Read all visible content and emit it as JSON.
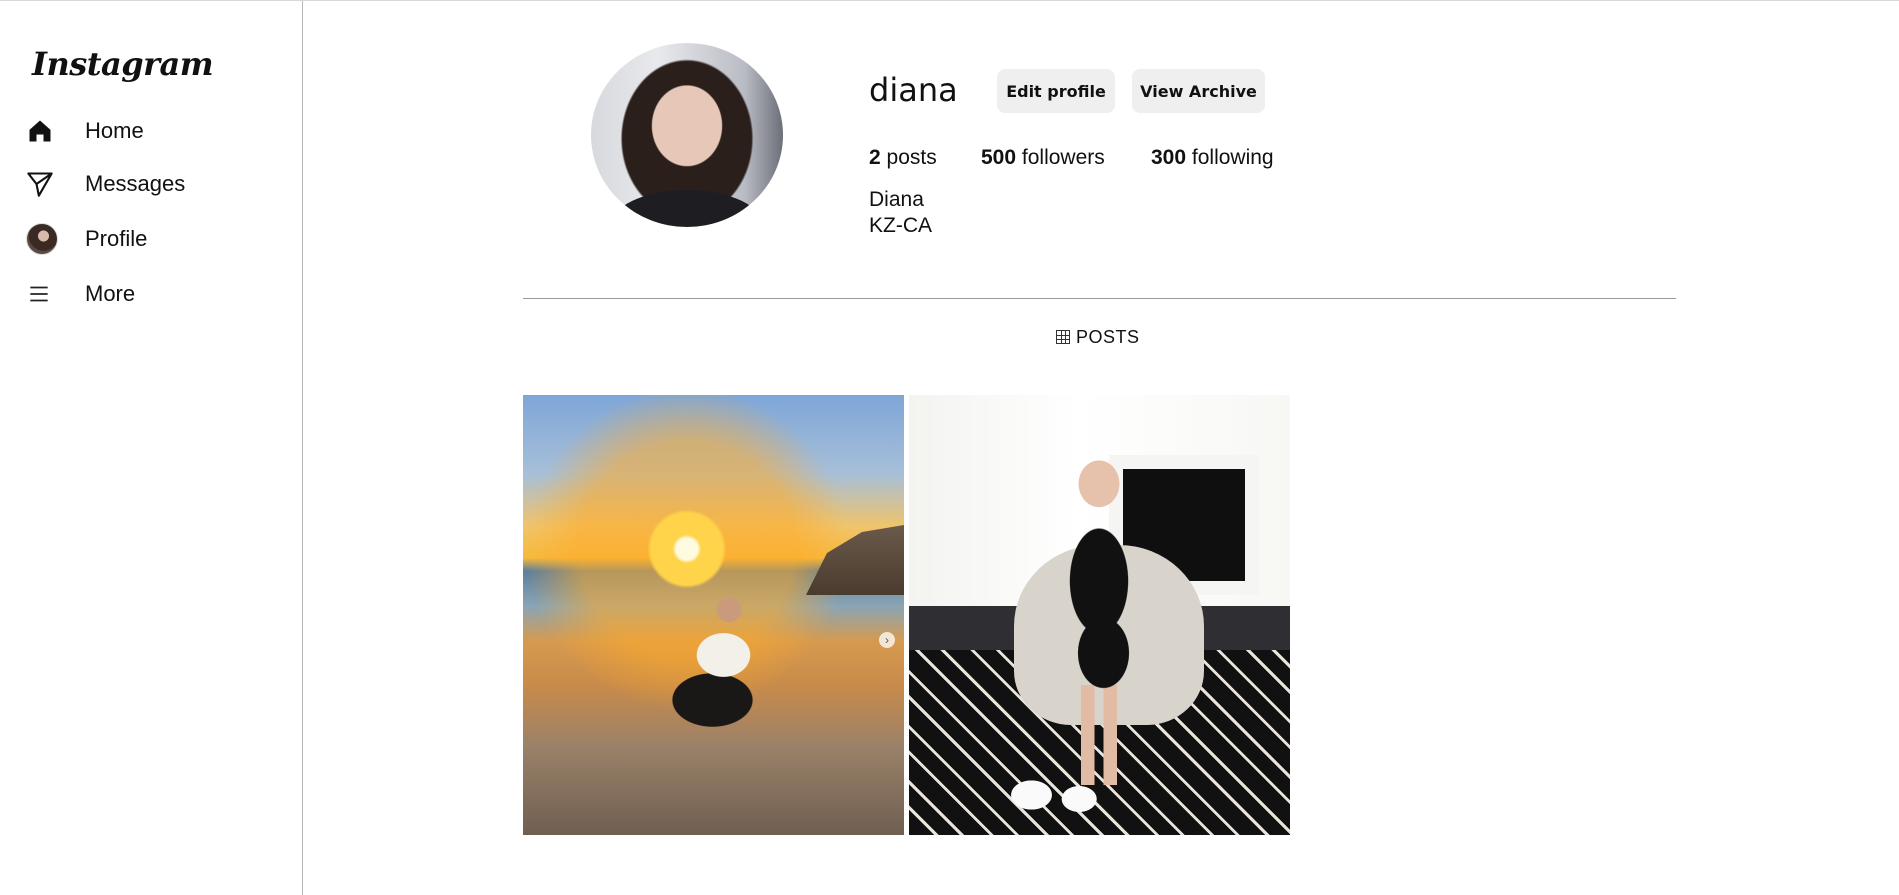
{
  "sidebar": {
    "logo": "Instagram",
    "items": [
      {
        "label": "Home",
        "icon": "home-icon"
      },
      {
        "label": "Messages",
        "icon": "send-icon"
      },
      {
        "label": "Profile",
        "icon": "avatar"
      },
      {
        "label": "More",
        "icon": "menu-icon"
      }
    ]
  },
  "profile": {
    "username": "diana",
    "edit_label": "Edit profile",
    "archive_label": "View Archive",
    "posts_count": "2",
    "posts_label": "posts",
    "followers_count": "500",
    "followers_label": "followers",
    "following_count": "300",
    "following_label": "following",
    "full_name": "Diana",
    "bio": "KZ-CA"
  },
  "tabs": {
    "posts_label": "POSTS",
    "posts_icon": "grid-icon"
  },
  "posts": [
    {
      "name": "post-beach-sunset",
      "has_carousel": true
    },
    {
      "name": "post-living-room-chair",
      "has_carousel": false
    }
  ]
}
